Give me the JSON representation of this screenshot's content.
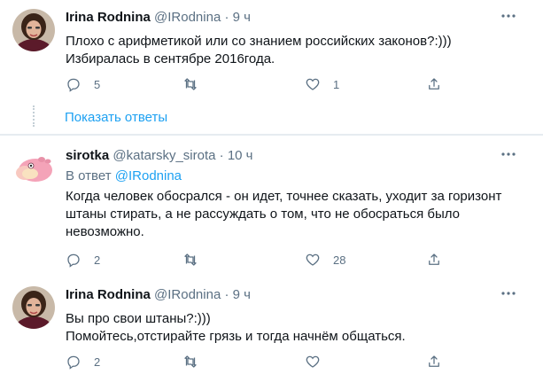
{
  "tweets": [
    {
      "name": "Irina Rodnina",
      "handle": "@IRodnina",
      "time": "9 ч",
      "lines": [
        "Плохо с арифметикой или со знанием российских законов?:)))",
        "Избиралась в сентябре 2016года."
      ],
      "reply_count": "5",
      "retweet_count": "",
      "like_count": "1"
    },
    {
      "name": "sirotka",
      "handle": "@katarsky_sirota",
      "time": "10 ч",
      "reply_prefix": "В ответ",
      "reply_to": "@IRodnina",
      "lines": [
        "Когда человек обосрался - он идет, точнее сказать, уходит за горизонт",
        "штаны стирать, а не рассуждать о том, что не обосраться было",
        "невозможно."
      ],
      "reply_count": "2",
      "retweet_count": "",
      "like_count": "28"
    },
    {
      "name": "Irina Rodnina",
      "handle": "@IRodnina",
      "time": "9 ч",
      "lines": [
        "Вы про свои штаны?:)))",
        "Помойтесь,отстирайте грязь и тогда начнём общаться."
      ],
      "reply_count": "2",
      "retweet_count": "",
      "like_count": ""
    }
  ],
  "show_replies_label": "Показать ответы",
  "separator": "·",
  "icons": {
    "more": "more-icon",
    "reply": "reply-icon",
    "retweet": "retweet-icon",
    "like": "like-icon",
    "share": "share-icon"
  },
  "colors": {
    "link": "#1da1f2",
    "muted": "#5b7083",
    "text": "#0f1419",
    "border": "#e6ecf0"
  }
}
